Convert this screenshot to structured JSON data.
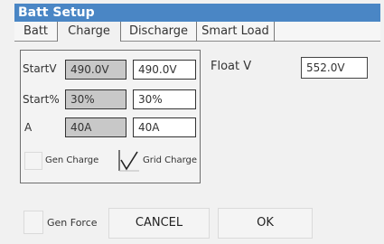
{
  "window": {
    "title": "Batt Setup"
  },
  "tabs": [
    {
      "label": "Batt"
    },
    {
      "label": "Charge"
    },
    {
      "label": "Discharge"
    },
    {
      "label": "Smart Load"
    }
  ],
  "active_tab": "Charge",
  "charge": {
    "start_v": {
      "label": "StartV",
      "current": "490.0V",
      "value": "490.0V"
    },
    "start_pct": {
      "label": "Start%",
      "current": "30%",
      "value": "30%"
    },
    "amps": {
      "label": "A",
      "current": "40A",
      "value": "40A"
    },
    "gen_charge": {
      "label": "Gen Charge",
      "checked": false
    },
    "grid_charge": {
      "label": "Grid Charge",
      "checked": true
    }
  },
  "float_v": {
    "label": "Float V",
    "value": "552.0V"
  },
  "gen_force": {
    "label": "Gen Force",
    "checked": false
  },
  "buttons": {
    "cancel": "CANCEL",
    "ok": "OK"
  },
  "colors": {
    "titlebar": "#4a86c5",
    "readonly_field": "#c8c8c8",
    "editable_field": "#ffffff"
  }
}
